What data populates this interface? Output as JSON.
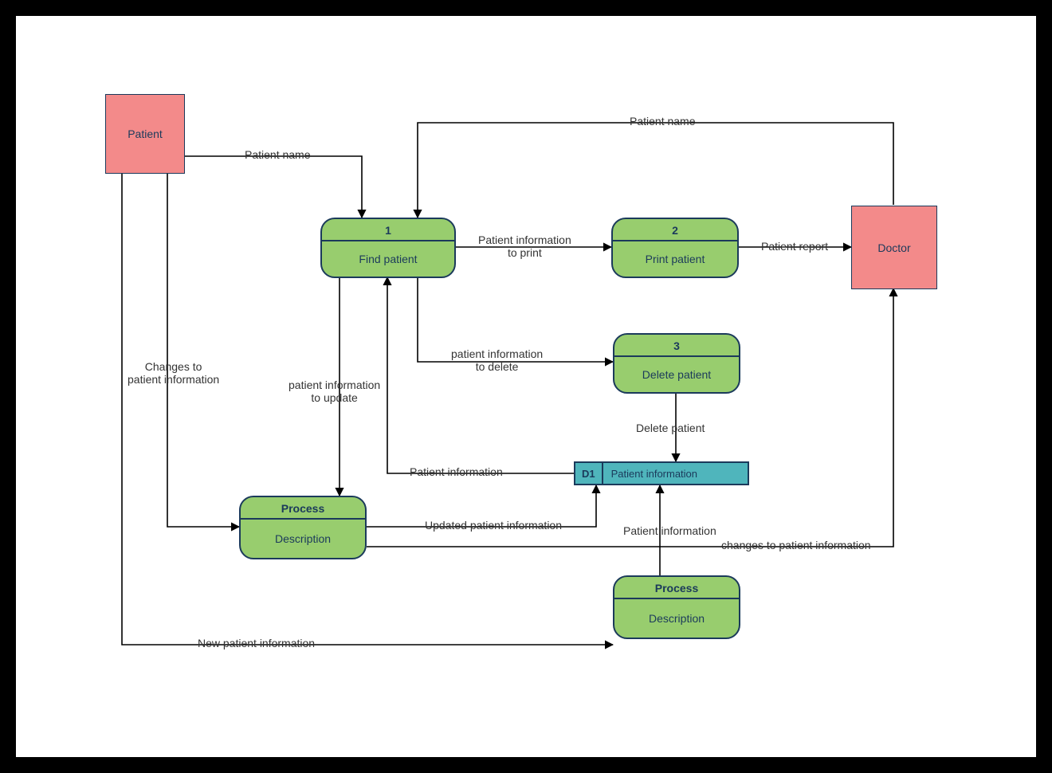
{
  "entities": {
    "patient": "Patient",
    "doctor": "Doctor"
  },
  "processes": {
    "p1": {
      "head": "1",
      "body": "Find patient"
    },
    "p2": {
      "head": "2",
      "body": "Print patient"
    },
    "p3": {
      "head": "3",
      "body": "Delete patient"
    },
    "p4": {
      "head": "Process",
      "body": "Description"
    },
    "p5": {
      "head": "Process",
      "body": "Description"
    }
  },
  "datastore": {
    "d1_id": "D1",
    "d1_body": "Patient information"
  },
  "flows": {
    "f_patient_to_find": "Patient name",
    "f_doctor_to_find": "Patient name",
    "f_find_to_print": "Patient information\nto print",
    "f_print_to_doctor": "Patient report",
    "f_find_to_delete": "patient information\nto delete",
    "f_delete_to_d1": "Delete patient",
    "f_d1_to_find": "Patient information",
    "f_find_to_p4": "patient information\nto update",
    "f_p4_to_d1": "Updated patient information",
    "f_d1_to_p5": "Patient information",
    "f_p4_to_doctor": "changes to patient information",
    "f_patient_to_p4": "Changes to\npatient information",
    "f_patient_to_p5": "New patient information"
  }
}
